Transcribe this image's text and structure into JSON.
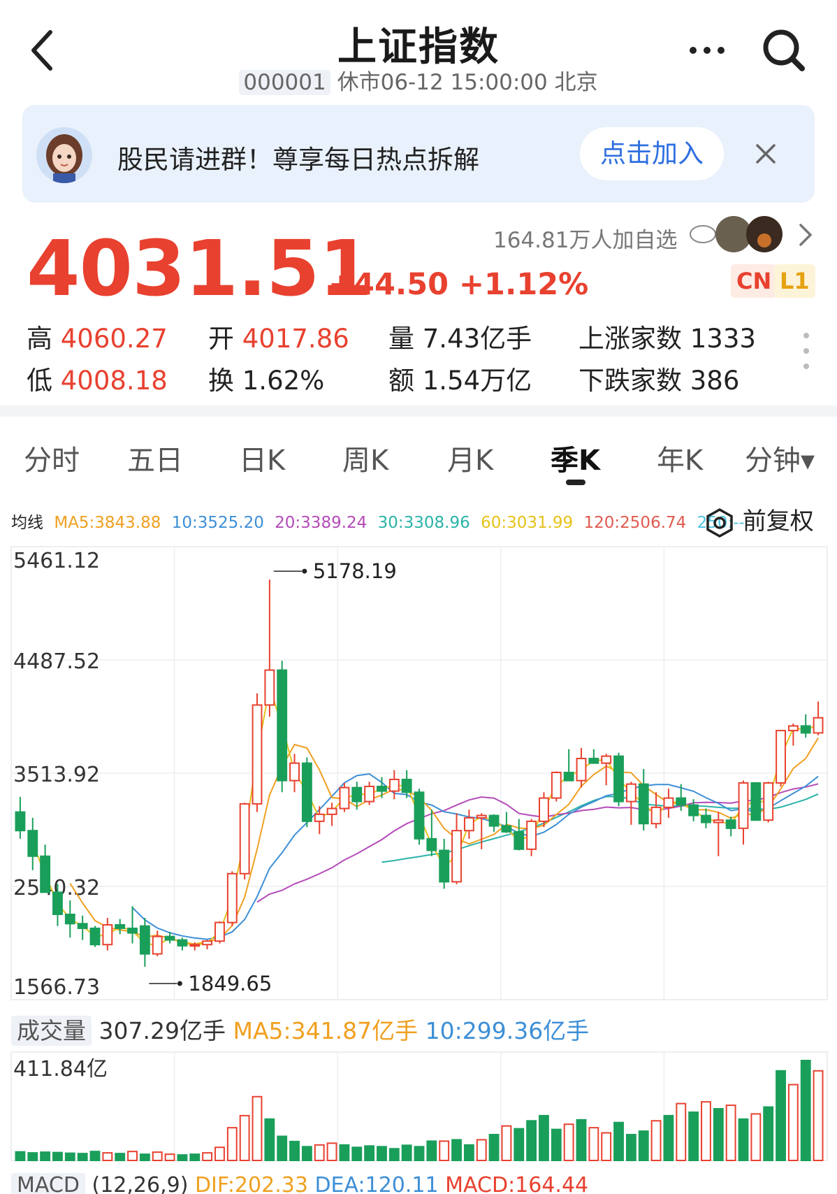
{
  "header": {
    "title": "上证指数",
    "code": "000001",
    "status": "休市06-12 15:00:00 北京"
  },
  "banner": {
    "text": "股民请进群！尊享每日热点拆解",
    "button": "点击加入"
  },
  "watch": {
    "text": "164.81万人加自选"
  },
  "quote": {
    "price": "4031.51",
    "change": "+44.50",
    "change_pct": "+1.12%",
    "badges": [
      "CN",
      "L1"
    ],
    "high_label": "高",
    "high": "4060.27",
    "low_label": "低",
    "low": "4008.18",
    "open_label": "开",
    "open": "4017.86",
    "turnover_label": "换",
    "turnover": "1.62%",
    "volume_label": "量",
    "volume": "7.43亿手",
    "amount_label": "额",
    "amount": "1.54万亿",
    "up_label": "上涨家数",
    "up": "1333",
    "down_label": "下跌家数",
    "down": "386"
  },
  "tabs": [
    {
      "label": "分时"
    },
    {
      "label": "五日"
    },
    {
      "label": "日K"
    },
    {
      "label": "周K"
    },
    {
      "label": "月K"
    },
    {
      "label": "季K",
      "active": true
    },
    {
      "label": "年K"
    },
    {
      "label": "分钟▾"
    }
  ],
  "ma": {
    "label": "均线",
    "ma5": "MA5:3843.88",
    "ma10": "10:3525.20",
    "ma20": "20:3389.24",
    "ma30": "30:3308.96",
    "ma60": "60:3031.99",
    "ma120": "120:2506.74",
    "ma250": "250:--"
  },
  "adjust_label": "前复权",
  "volume_panel": {
    "label": "成交量",
    "value": "307.29亿手",
    "ma5": "MA5:341.87亿手",
    "ma10": "10:299.36亿手",
    "axis_max": "411.84亿"
  },
  "macd_panel": {
    "label": "MACD",
    "params": "(12,26,9)",
    "dif": "DIF:202.33",
    "dea": "DEA:120.11",
    "macd": "MACD:164.44"
  },
  "colors": {
    "up": "#e8412f",
    "down": "#1a9f5b",
    "accent": "#2f6fe0",
    "ma5": "#f0a020",
    "ma10": "#3d8fd6",
    "ma20": "#b44bb8",
    "ma30": "#2bb3a8",
    "ma60": "#e6c21a",
    "ma120": "#e05a4f"
  },
  "chart_data": {
    "type": "candlestick",
    "ylim": [
      1566.73,
      5461.12
    ],
    "y_ticks": [
      "5461.12",
      "4487.52",
      "3513.92",
      "2540.32",
      "1566.73"
    ],
    "annotations": {
      "max": "5178.19",
      "min": "1849.65"
    },
    "candles": [
      {
        "o": 3180,
        "h": 3310,
        "l": 2950,
        "c": 3020
      },
      {
        "o": 3020,
        "h": 3130,
        "l": 2680,
        "c": 2800
      },
      {
        "o": 2800,
        "h": 2900,
        "l": 2560,
        "c": 2490
      },
      {
        "o": 2490,
        "h": 2560,
        "l": 2200,
        "c": 2300
      },
      {
        "o": 2300,
        "h": 2420,
        "l": 2100,
        "c": 2220
      },
      {
        "o": 2220,
        "h": 2290,
        "l": 2080,
        "c": 2180
      },
      {
        "o": 2180,
        "h": 2200,
        "l": 2020,
        "c": 2040
      },
      {
        "o": 2040,
        "h": 2270,
        "l": 1990,
        "c": 2210
      },
      {
        "o": 2210,
        "h": 2260,
        "l": 2130,
        "c": 2180
      },
      {
        "o": 2180,
        "h": 2370,
        "l": 2050,
        "c": 2140
      },
      {
        "o": 2200,
        "h": 2270,
        "l": 1849.65,
        "c": 1960
      },
      {
        "o": 1960,
        "h": 2160,
        "l": 1940,
        "c": 2110
      },
      {
        "o": 2110,
        "h": 2150,
        "l": 2050,
        "c": 2080
      },
      {
        "o": 2080,
        "h": 2100,
        "l": 1990,
        "c": 2030
      },
      {
        "o": 2030,
        "h": 2060,
        "l": 1990,
        "c": 2040
      },
      {
        "o": 2040,
        "h": 2080,
        "l": 2000,
        "c": 2070
      },
      {
        "o": 2070,
        "h": 2240,
        "l": 2050,
        "c": 2230
      },
      {
        "o": 2230,
        "h": 2670,
        "l": 2200,
        "c": 2650
      },
      {
        "o": 2650,
        "h": 3260,
        "l": 2600,
        "c": 3250
      },
      {
        "o": 3250,
        "h": 4200,
        "l": 3180,
        "c": 4100
      },
      {
        "o": 4100,
        "h": 5178.19,
        "l": 4000,
        "c": 4400
      },
      {
        "o": 4400,
        "h": 4480,
        "l": 3350,
        "c": 3450
      },
      {
        "o": 3450,
        "h": 3680,
        "l": 3350,
        "c": 3600
      },
      {
        "o": 3600,
        "h": 3650,
        "l": 3050,
        "c": 3100
      },
      {
        "o": 3100,
        "h": 3230,
        "l": 2990,
        "c": 3160
      },
      {
        "o": 3160,
        "h": 3260,
        "l": 3060,
        "c": 3210
      },
      {
        "o": 3210,
        "h": 3430,
        "l": 3180,
        "c": 3390
      },
      {
        "o": 3390,
        "h": 3440,
        "l": 3200,
        "c": 3270
      },
      {
        "o": 3270,
        "h": 3440,
        "l": 3240,
        "c": 3400
      },
      {
        "o": 3400,
        "h": 3480,
        "l": 3300,
        "c": 3360
      },
      {
        "o": 3360,
        "h": 3540,
        "l": 3290,
        "c": 3460
      },
      {
        "o": 3460,
        "h": 3540,
        "l": 3300,
        "c": 3350
      },
      {
        "o": 3350,
        "h": 3380,
        "l": 2900,
        "c": 2950
      },
      {
        "o": 2950,
        "h": 3200,
        "l": 2800,
        "c": 2850
      },
      {
        "o": 2850,
        "h": 2950,
        "l": 2520,
        "c": 2580
      },
      {
        "o": 2580,
        "h": 3170,
        "l": 2560,
        "c": 3020
      },
      {
        "o": 3020,
        "h": 3200,
        "l": 2950,
        "c": 3130
      },
      {
        "o": 3130,
        "h": 3170,
        "l": 2860,
        "c": 3150
      },
      {
        "o": 3150,
        "h": 3160,
        "l": 3010,
        "c": 3060
      },
      {
        "o": 3060,
        "h": 3180,
        "l": 3000,
        "c": 3010
      },
      {
        "o": 3010,
        "h": 3120,
        "l": 2850,
        "c": 2860
      },
      {
        "o": 2860,
        "h": 3120,
        "l": 2800,
        "c": 3100
      },
      {
        "o": 3100,
        "h": 3350,
        "l": 3050,
        "c": 3300
      },
      {
        "o": 3300,
        "h": 3530,
        "l": 3270,
        "c": 3520
      },
      {
        "o": 3520,
        "h": 3720,
        "l": 3460,
        "c": 3450
      },
      {
        "o": 3450,
        "h": 3730,
        "l": 3390,
        "c": 3640
      },
      {
        "o": 3640,
        "h": 3720,
        "l": 3600,
        "c": 3600
      },
      {
        "o": 3600,
        "h": 3680,
        "l": 3410,
        "c": 3660
      },
      {
        "o": 3660,
        "h": 3690,
        "l": 3230,
        "c": 3270
      },
      {
        "o": 3270,
        "h": 3440,
        "l": 3070,
        "c": 3420
      },
      {
        "o": 3420,
        "h": 3550,
        "l": 3020,
        "c": 3080
      },
      {
        "o": 3080,
        "h": 3350,
        "l": 3040,
        "c": 3220
      },
      {
        "o": 3220,
        "h": 3380,
        "l": 3130,
        "c": 3300
      },
      {
        "o": 3300,
        "h": 3420,
        "l": 3190,
        "c": 3240
      },
      {
        "o": 3240,
        "h": 3290,
        "l": 3100,
        "c": 3150
      },
      {
        "o": 3150,
        "h": 3210,
        "l": 3040,
        "c": 3090
      },
      {
        "o": 3090,
        "h": 3180,
        "l": 2800,
        "c": 3110
      },
      {
        "o": 3110,
        "h": 3140,
        "l": 2970,
        "c": 3040
      },
      {
        "o": 3040,
        "h": 3450,
        "l": 2900,
        "c": 3430
      },
      {
        "o": 3430,
        "h": 3420,
        "l": 3140,
        "c": 3110
      },
      {
        "o": 3110,
        "h": 3440,
        "l": 3090,
        "c": 3430
      },
      {
        "o": 3430,
        "h": 3880,
        "l": 3400,
        "c": 3880
      },
      {
        "o": 3880,
        "h": 3940,
        "l": 3750,
        "c": 3920
      },
      {
        "o": 3920,
        "h": 4020,
        "l": 3820,
        "c": 3860
      },
      {
        "o": 3860,
        "h": 4130,
        "l": 3840,
        "c": 3990
      }
    ],
    "volume": [
      {
        "v": 25,
        "up": false
      },
      {
        "v": 22,
        "up": false
      },
      {
        "v": 24,
        "up": false
      },
      {
        "v": 23,
        "up": false
      },
      {
        "v": 21,
        "up": false
      },
      {
        "v": 20,
        "up": false
      },
      {
        "v": 26,
        "up": false
      },
      {
        "v": 22,
        "up": true
      },
      {
        "v": 20,
        "up": false
      },
      {
        "v": 26,
        "up": true
      },
      {
        "v": 18,
        "up": false
      },
      {
        "v": 24,
        "up": true
      },
      {
        "v": 18,
        "up": true
      },
      {
        "v": 16,
        "up": false
      },
      {
        "v": 18,
        "up": false
      },
      {
        "v": 22,
        "up": true
      },
      {
        "v": 38,
        "up": true
      },
      {
        "v": 95,
        "up": true
      },
      {
        "v": 130,
        "up": true
      },
      {
        "v": 185,
        "up": true
      },
      {
        "v": 120,
        "up": false
      },
      {
        "v": 70,
        "up": false
      },
      {
        "v": 55,
        "up": false
      },
      {
        "v": 40,
        "up": false
      },
      {
        "v": 45,
        "up": true
      },
      {
        "v": 50,
        "up": true
      },
      {
        "v": 45,
        "up": false
      },
      {
        "v": 38,
        "up": false
      },
      {
        "v": 42,
        "up": false
      },
      {
        "v": 40,
        "up": false
      },
      {
        "v": 34,
        "up": false
      },
      {
        "v": 44,
        "up": false
      },
      {
        "v": 40,
        "up": false
      },
      {
        "v": 56,
        "up": false
      },
      {
        "v": 56,
        "up": true
      },
      {
        "v": 60,
        "up": false
      },
      {
        "v": 45,
        "up": false
      },
      {
        "v": 60,
        "up": true
      },
      {
        "v": 75,
        "up": false
      },
      {
        "v": 100,
        "up": true
      },
      {
        "v": 92,
        "up": false
      },
      {
        "v": 115,
        "up": false
      },
      {
        "v": 130,
        "up": false
      },
      {
        "v": 90,
        "up": false
      },
      {
        "v": 105,
        "up": true
      },
      {
        "v": 118,
        "up": false
      },
      {
        "v": 95,
        "up": true
      },
      {
        "v": 80,
        "up": true
      },
      {
        "v": 110,
        "up": false
      },
      {
        "v": 75,
        "up": false
      },
      {
        "v": 85,
        "up": false
      },
      {
        "v": 115,
        "up": true
      },
      {
        "v": 130,
        "up": false
      },
      {
        "v": 165,
        "up": true
      },
      {
        "v": 140,
        "up": false
      },
      {
        "v": 170,
        "up": true
      },
      {
        "v": 150,
        "up": false
      },
      {
        "v": 160,
        "up": true
      },
      {
        "v": 120,
        "up": false
      },
      {
        "v": 135,
        "up": true
      },
      {
        "v": 155,
        "up": false
      },
      {
        "v": 260,
        "up": false
      },
      {
        "v": 220,
        "up": true
      },
      {
        "v": 290,
        "up": false
      },
      {
        "v": 260,
        "up": true
      }
    ]
  }
}
